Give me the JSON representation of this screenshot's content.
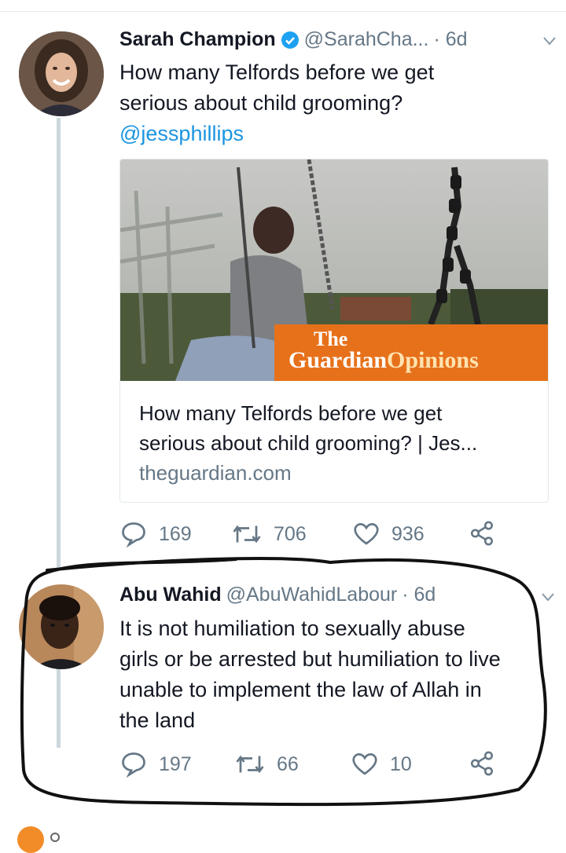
{
  "tweet1": {
    "name": "Sarah Champion",
    "handle": "@SarahCha...",
    "time": "· 6d",
    "text_line1": "How many Telfords before we get",
    "text_line2": "serious about child grooming?",
    "mention": "@jessphillips",
    "card": {
      "brand_the": "The",
      "brand_guardian": "Guardian",
      "brand_opinions": "Opinions",
      "title_line1": "How many Telfords before we get",
      "title_line2": "serious about child grooming? | Jes...",
      "domain": "theguardian.com"
    },
    "replies": "169",
    "retweets": "706",
    "likes": "936"
  },
  "tweet2": {
    "name": "Abu Wahid",
    "handle": "@AbuWahidLabour",
    "time": "· 6d",
    "text_line1": "It is not humiliation to sexually abuse",
    "text_line2": "girls or be arrested but humiliation to live",
    "text_line3": "unable to implement the law of Allah in",
    "text_line4": "the land",
    "replies": "197",
    "retweets": "66",
    "likes": "10"
  },
  "colors": {
    "verified": "#1da1f2",
    "link": "#1b95e0",
    "muted": "#657786",
    "guardian_orange": "#e7711b"
  },
  "icons": [
    "reply-icon",
    "retweet-icon",
    "like-icon",
    "share-icon",
    "verified-badge-icon",
    "chevron-down-icon"
  ]
}
